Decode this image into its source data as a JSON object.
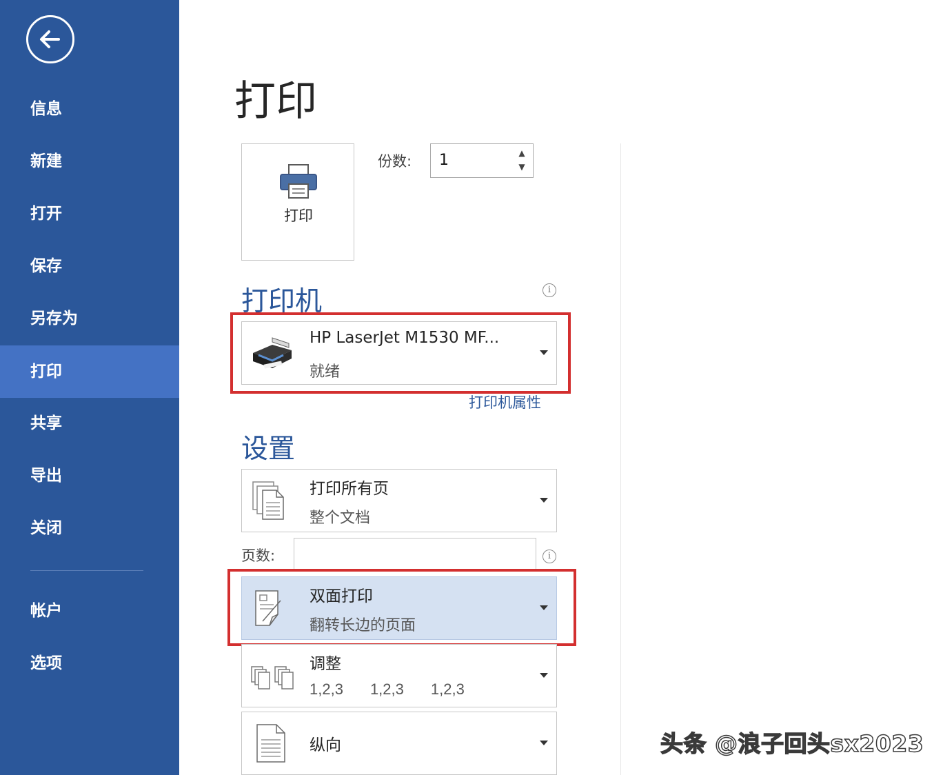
{
  "sidebar": {
    "items": [
      {
        "label": "信息"
      },
      {
        "label": "新建"
      },
      {
        "label": "打开"
      },
      {
        "label": "保存"
      },
      {
        "label": "另存为"
      },
      {
        "label": "打印"
      },
      {
        "label": "共享"
      },
      {
        "label": "导出"
      },
      {
        "label": "关闭"
      },
      {
        "label": "帐户"
      },
      {
        "label": "选项"
      }
    ],
    "active_item": "打印"
  },
  "main": {
    "title": "打印",
    "print_button_label": "打印",
    "copies": {
      "label": "份数:",
      "value": "1"
    },
    "printer_section": {
      "title": "打印机",
      "printer_name": "HP LaserJet M1530 MF...",
      "printer_status": "就绪",
      "properties_link": "打印机属性"
    },
    "settings_section": {
      "title": "设置",
      "print_range": {
        "main": "打印所有页",
        "sub": "整个文档"
      },
      "pages": {
        "label": "页数:",
        "value": ""
      },
      "duplex": {
        "main": "双面打印",
        "sub": "翻转长边的页面"
      },
      "collate": {
        "main": "调整",
        "groups": [
          "1,2,3",
          "1,2,3",
          "1,2,3"
        ]
      },
      "orientation": {
        "main": "纵向"
      }
    }
  },
  "icons": {
    "back": "back-arrow-icon",
    "printer": "printer-icon",
    "info": "info-icon",
    "dropdown": "chevron-down-icon",
    "pages_stack": "pages-stack-icon",
    "duplex": "duplex-page-icon",
    "collate": "collate-icon",
    "portrait": "portrait-page-icon"
  },
  "colors": {
    "sidebar_bg": "#2b579a",
    "sidebar_active": "#4472c4",
    "accent_text": "#2b579a",
    "highlight_border": "#d32f2f",
    "selected_dropdown_bg": "#d5e1f2"
  },
  "watermark": "头条 @浪子回头sx2023"
}
